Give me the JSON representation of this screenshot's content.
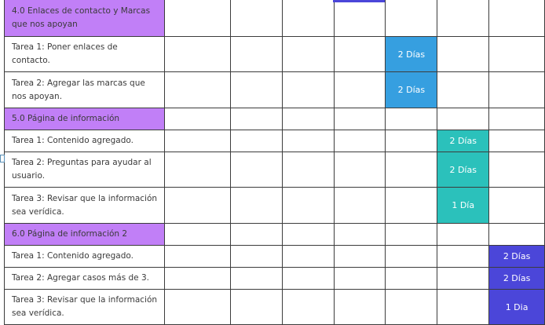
{
  "colors": {
    "section": "#c17ff7",
    "blue": "#369fe0",
    "teal": "#2bc1bb",
    "indigo": "#4b46d9"
  },
  "rows": [
    {
      "label": "4.0 Enlaces de contacto y Marcas que nos apoyan",
      "type": "section"
    },
    {
      "label": "Tarea 1: Poner enlaces de contacto.",
      "type": "task",
      "bar": {
        "col": 4,
        "text": "2 Días",
        "color": "blue"
      }
    },
    {
      "label": "Tarea 2: Agregar las marcas que nos apoyan.",
      "type": "task",
      "bar": {
        "col": 4,
        "text": "2 Días",
        "color": "blue"
      }
    },
    {
      "label": "5.0 Página de información",
      "type": "section"
    },
    {
      "label": "Tarea 1: Contenido agregado.",
      "type": "task",
      "bar": {
        "col": 5,
        "text": "2 Días",
        "color": "teal"
      }
    },
    {
      "label": "Tarea 2: Preguntas para ayudar al usuario.",
      "type": "task",
      "bar": {
        "col": 5,
        "text": "2 Días",
        "color": "teal"
      }
    },
    {
      "label": "Tarea 3: Revisar que la información sea verídica.",
      "type": "task",
      "bar": {
        "col": 5,
        "text": "1 Día",
        "color": "teal"
      }
    },
    {
      "label": "6.0 Página de información 2",
      "type": "section"
    },
    {
      "label": "Tarea 1: Contenido agregado.",
      "type": "task",
      "bar": {
        "col": 6,
        "text": "2 Días",
        "color": "indigo"
      }
    },
    {
      "label": "Tarea 2: Agregar casos más de 3.",
      "type": "task",
      "bar": {
        "col": 6,
        "text": "2 Días",
        "color": "indigo"
      }
    },
    {
      "label": "Tarea 3: Revisar que la información sea verídica.",
      "type": "task",
      "bar": {
        "col": 6,
        "text": "1 Dia",
        "color": "indigo"
      }
    }
  ]
}
